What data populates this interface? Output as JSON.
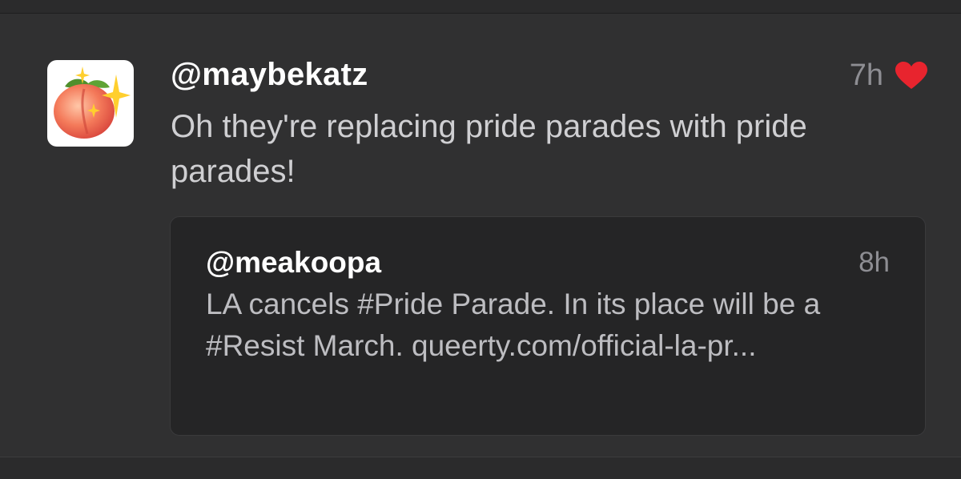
{
  "tweet": {
    "handle": "@maybekatz",
    "time": "7h",
    "text": "Oh they're replacing pride parades with pride parades!",
    "avatar_icon": "peach-sparkles-icon",
    "liked": true,
    "heart_color": "#e8242e"
  },
  "quoted": {
    "handle": "@meakoopa",
    "time": "8h",
    "text": "LA cancels #Pride Parade. In its place will be a #Resist March. queerty.com/official-la-pr..."
  }
}
